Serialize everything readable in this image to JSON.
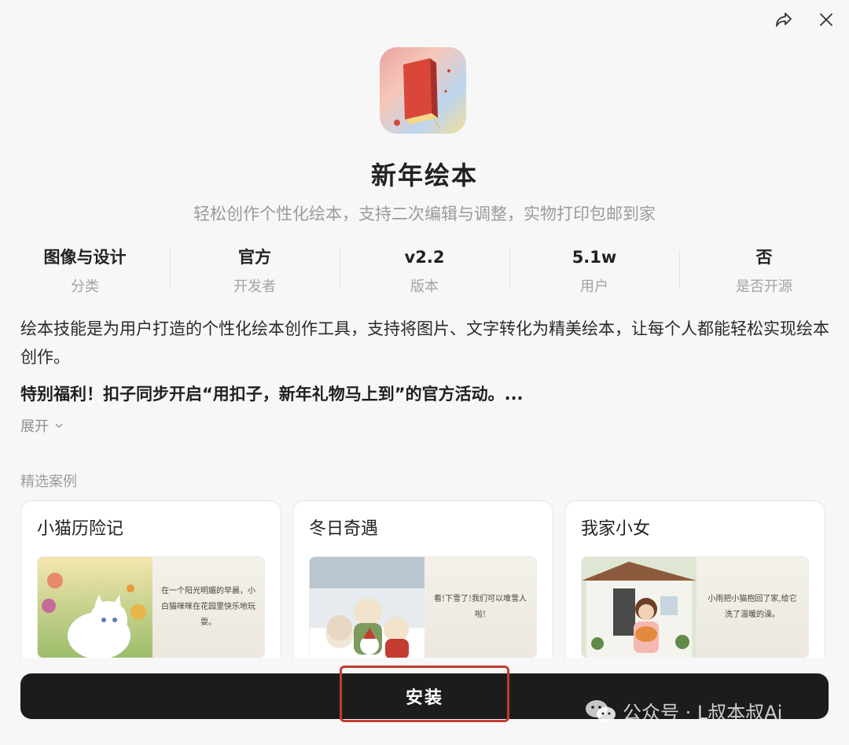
{
  "app": {
    "name": "新年绘本",
    "tagline": "轻松创作个性化绘本，支持二次编辑与调整，实物打印包邮到家"
  },
  "stats": [
    {
      "value": "图像与设计",
      "label": "分类"
    },
    {
      "value": "官方",
      "label": "开发者"
    },
    {
      "value": "v2.2",
      "label": "版本"
    },
    {
      "value": "5.1w",
      "label": "用户"
    },
    {
      "value": "否",
      "label": "是否开源"
    }
  ],
  "description": "绘本技能是为用户打造的个性化绘本创作工具，支持将图片、文字转化为精美绘本，让每个人都能轻松实现绘本创作。",
  "bonus": "特别福利！扣子同步开启“用扣子，新年礼物马上到”的官方活动。...",
  "expand_label": "展开",
  "section_label": "精选案例",
  "cases": [
    {
      "title": "小猫历险记",
      "caption": "在一个阳光明媚的早晨，小白猫咪咪在花园里快乐地玩耍。"
    },
    {
      "title": "冬日奇遇",
      "caption": "看!下雪了!我们可以堆雪人啦!"
    },
    {
      "title": "我家小女",
      "caption": "小雨把小猫抱回了家,给它洗了温暖的澡。"
    }
  ],
  "install_label": "安装",
  "watermark": "公众号 · L叔本叔Ai",
  "colors": {
    "install_bg": "#1c1c1c",
    "highlight": "#c43b30"
  },
  "icons": {
    "share": "share-icon",
    "close": "close-icon",
    "expand": "chevron-down-icon",
    "watermark": "wechat-icon"
  }
}
